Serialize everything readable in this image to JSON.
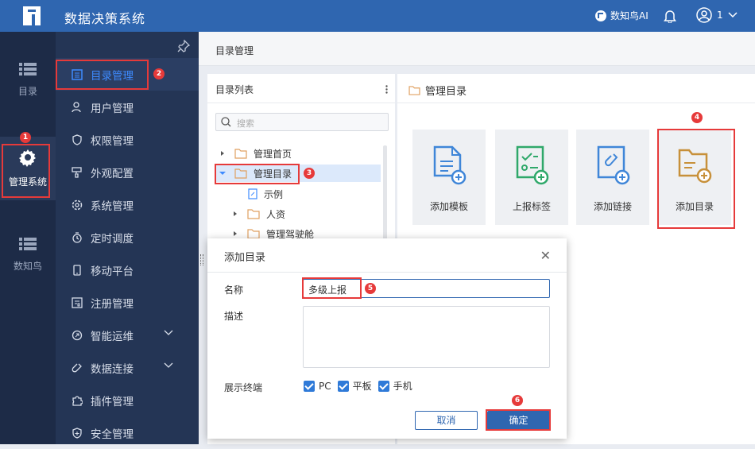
{
  "app": {
    "title": "数据决策系统",
    "ai_label": "数知鸟AI",
    "user_label": "1"
  },
  "rail": [
    {
      "label": "目录",
      "icon": "list-icon"
    },
    {
      "label": "管理系统",
      "icon": "gear-icon"
    },
    {
      "label": "数知鸟",
      "icon": "list-icon"
    }
  ],
  "menu": [
    {
      "label": "目录管理",
      "icon": "catalog-icon"
    },
    {
      "label": "用户管理",
      "icon": "user-icon"
    },
    {
      "label": "权限管理",
      "icon": "shield-icon"
    },
    {
      "label": "外观配置",
      "icon": "brush-icon"
    },
    {
      "label": "系统管理",
      "icon": "settings-icon"
    },
    {
      "label": "定时调度",
      "icon": "timer-icon"
    },
    {
      "label": "移动平台",
      "icon": "mobile-icon"
    },
    {
      "label": "注册管理",
      "icon": "register-icon"
    },
    {
      "label": "智能运维",
      "icon": "ops-icon"
    },
    {
      "label": "数据连接",
      "icon": "link-icon"
    },
    {
      "label": "插件管理",
      "icon": "plugin-icon"
    },
    {
      "label": "安全管理",
      "icon": "security-icon"
    }
  ],
  "breadcrumb": "目录管理",
  "tree_panel": {
    "title": "目录列表",
    "search_placeholder": "搜索"
  },
  "tree": [
    {
      "label": "管理首页"
    },
    {
      "label": "管理目录"
    },
    {
      "label": "示例"
    },
    {
      "label": "人资"
    },
    {
      "label": "管理驾驶舱"
    }
  ],
  "right_panel": {
    "title": "管理目录"
  },
  "cards": [
    {
      "label": "添加模板",
      "icon": "add-template-icon",
      "color": "#3f86d8"
    },
    {
      "label": "上报标签",
      "icon": "report-tag-icon",
      "color": "#2fa86a"
    },
    {
      "label": "添加链接",
      "icon": "add-link-icon",
      "color": "#3f86d8"
    },
    {
      "label": "添加目录",
      "icon": "add-folder-icon",
      "color": "#c7903a"
    }
  ],
  "dialog": {
    "title": "添加目录",
    "name_label": "名称",
    "name_value": "多级上报",
    "desc_label": "描述",
    "terminal_label": "展示终端",
    "terminals": [
      "PC",
      "平板",
      "手机"
    ],
    "cancel": "取消",
    "ok": "确定"
  },
  "badges": [
    "1",
    "2",
    "3",
    "4",
    "5",
    "6"
  ],
  "colors": {
    "topbar": "#2f66b0",
    "sidebar": "#243555",
    "accent": "#3e8bff",
    "highlight": "#e63a3a"
  }
}
